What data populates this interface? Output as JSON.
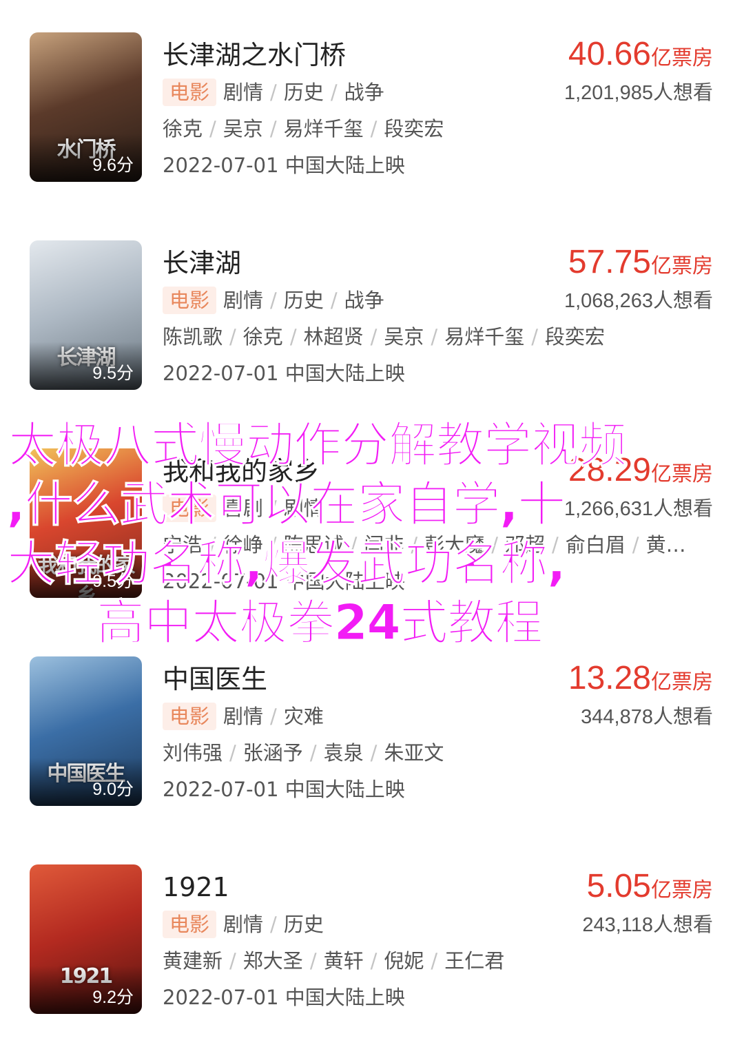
{
  "movies": [
    {
      "title": "长津湖之水门桥",
      "score": "9.6分",
      "poster_title": "水门桥",
      "poster_colors": [
        "#5b3a2a",
        "#c7a27d",
        "#2b1e17"
      ],
      "tag": "电影",
      "genres": [
        "剧情",
        "历史",
        "战争"
      ],
      "cast": [
        "徐克",
        "吴京",
        "易烊千玺",
        "段奕宏"
      ],
      "date": "2022-07-01 中国大陆上映",
      "box_office": "40.66",
      "box_unit": "亿票房",
      "want": "1,201,985人想看"
    },
    {
      "title": "长津湖",
      "score": "9.5分",
      "poster_title": "长津湖",
      "poster_colors": [
        "#aeb9c4",
        "#e3e8ed",
        "#6a7680"
      ],
      "tag": "电影",
      "genres": [
        "剧情",
        "历史",
        "战争"
      ],
      "cast": [
        "陈凯歌",
        "徐克",
        "林超贤",
        "吴京",
        "易烊千玺",
        "段奕宏"
      ],
      "date": "2022-07-01 中国大陆上映",
      "box_office": "57.75",
      "box_unit": "亿票房",
      "want": "1,068,263人想看"
    },
    {
      "title": "我和我的家乡",
      "score": "9.5分",
      "poster_title": "我和我的家乡",
      "poster_colors": [
        "#d9462e",
        "#f1c25a",
        "#7b2a1d"
      ],
      "tag": "电影",
      "genres": [
        "喜剧",
        "剧情"
      ],
      "cast": [
        "宁浩",
        "徐峥",
        "陈思诚",
        "闫非",
        "彭大魔",
        "邓超",
        "俞白眉",
        "黄…"
      ],
      "date": "2022-07-01 中国大陆上映",
      "box_office": "28.29",
      "box_unit": "亿票房",
      "want": "1,266,631人想看"
    },
    {
      "title": "中国医生",
      "score": "9.0分",
      "poster_title": "中国医生",
      "poster_colors": [
        "#3b6ea6",
        "#9cc0de",
        "#1e3c5e"
      ],
      "tag": "电影",
      "genres": [
        "剧情",
        "灾难"
      ],
      "cast": [
        "刘伟强",
        "张涵予",
        "袁泉",
        "朱亚文"
      ],
      "date": "2022-07-01 中国大陆上映",
      "box_office": "13.28",
      "box_unit": "亿票房",
      "want": "344,878人想看"
    },
    {
      "title": "1921",
      "score": "9.2分",
      "poster_title": "1921",
      "poster_colors": [
        "#b32a20",
        "#e05a3a",
        "#5a1510"
      ],
      "tag": "电影",
      "genres": [
        "剧情",
        "历史"
      ],
      "cast": [
        "黄建新",
        "郑大圣",
        "黄轩",
        "倪妮",
        "王仁君"
      ],
      "date": "2022-07-01 中国大陆上映",
      "box_office": "5.05",
      "box_unit": "亿票房",
      "want": "243,118人想看"
    }
  ],
  "overlay": {
    "line1": "太极八式慢动作分解教学视频",
    "line2": ",什么武术可以在家自学,十",
    "line3": "大轻功名称,爆发武功名称,",
    "line4": "高中太极拳24式教程",
    "color": "#f21cf5"
  }
}
